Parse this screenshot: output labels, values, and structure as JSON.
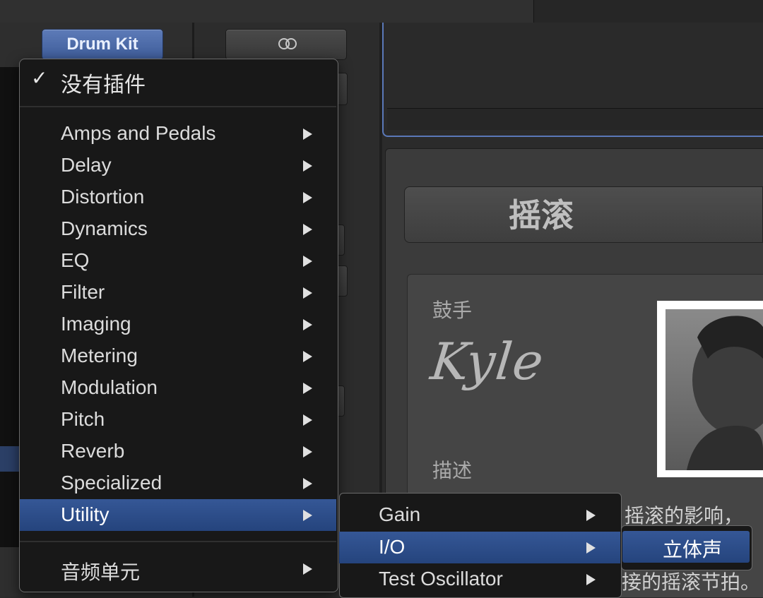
{
  "header": {
    "patch_button": "Drum Kit",
    "link_icon": "linked-circles-icon"
  },
  "plugin_menu": {
    "none_item": "没有插件",
    "check_icon": "checkmark-icon",
    "items": [
      {
        "label": "Amps and Pedals"
      },
      {
        "label": "Delay"
      },
      {
        "label": "Distortion"
      },
      {
        "label": "Dynamics"
      },
      {
        "label": "EQ"
      },
      {
        "label": "Filter"
      },
      {
        "label": "Imaging"
      },
      {
        "label": "Metering"
      },
      {
        "label": "Modulation"
      },
      {
        "label": "Pitch"
      },
      {
        "label": "Reverb"
      },
      {
        "label": "Specialized"
      },
      {
        "label": "Utility",
        "selected": true
      }
    ],
    "audio_units": "音频单元"
  },
  "utility_submenu": {
    "items": [
      {
        "label": "Gain"
      },
      {
        "label": "I/O",
        "selected": true
      },
      {
        "label": "Test Oscillator"
      }
    ]
  },
  "io_submenu": {
    "items": [
      {
        "label": "立体声",
        "selected": true
      }
    ]
  },
  "drummer_panel": {
    "genre": "摇滚",
    "drummer_label": "鼓手",
    "drummer_name": "Kyle",
    "description_label": "描述",
    "description_lines": [
      "摇滚的影响，",
      "接的摇滚节拍。"
    ],
    "avatar": "drummer-portrait"
  },
  "colors": {
    "accent": "#355796",
    "menu_bg": "#181818",
    "panel_bg": "#3b3b3b"
  }
}
